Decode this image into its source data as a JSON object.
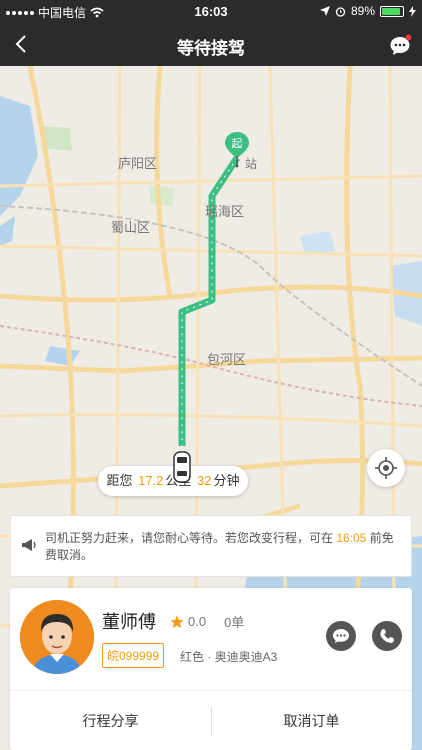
{
  "status_bar": {
    "carrier": "中国电信",
    "time": "16:03",
    "battery": "89%",
    "battery_level": 0.89
  },
  "header": {
    "title": "等待接驾"
  },
  "map": {
    "districts": [
      "庐阳区",
      "蜀山区",
      "瑶海区",
      "包河区"
    ],
    "station_label": "站",
    "start_marker": "起",
    "distance": {
      "prefix": "距您",
      "km": "17.2",
      "km_unit": "公里",
      "minutes": "32",
      "minutes_unit": "分钟"
    }
  },
  "notice": {
    "text_before": "司机正努力赶来，请您耐心等待。若您改变行程，可在 ",
    "time": "16:05",
    "text_after": " 前免费取消。"
  },
  "driver": {
    "name": "董师傅",
    "rating": "0.0",
    "orders": "0单",
    "plate": "皖099999",
    "car": "红色 · 奥迪奥迪A3"
  },
  "actions": {
    "share": "行程分享",
    "cancel": "取消订单"
  },
  "colors": {
    "route": "#3dbf84",
    "accent": "#f39c12",
    "header_bg": "#2b2b2b"
  }
}
